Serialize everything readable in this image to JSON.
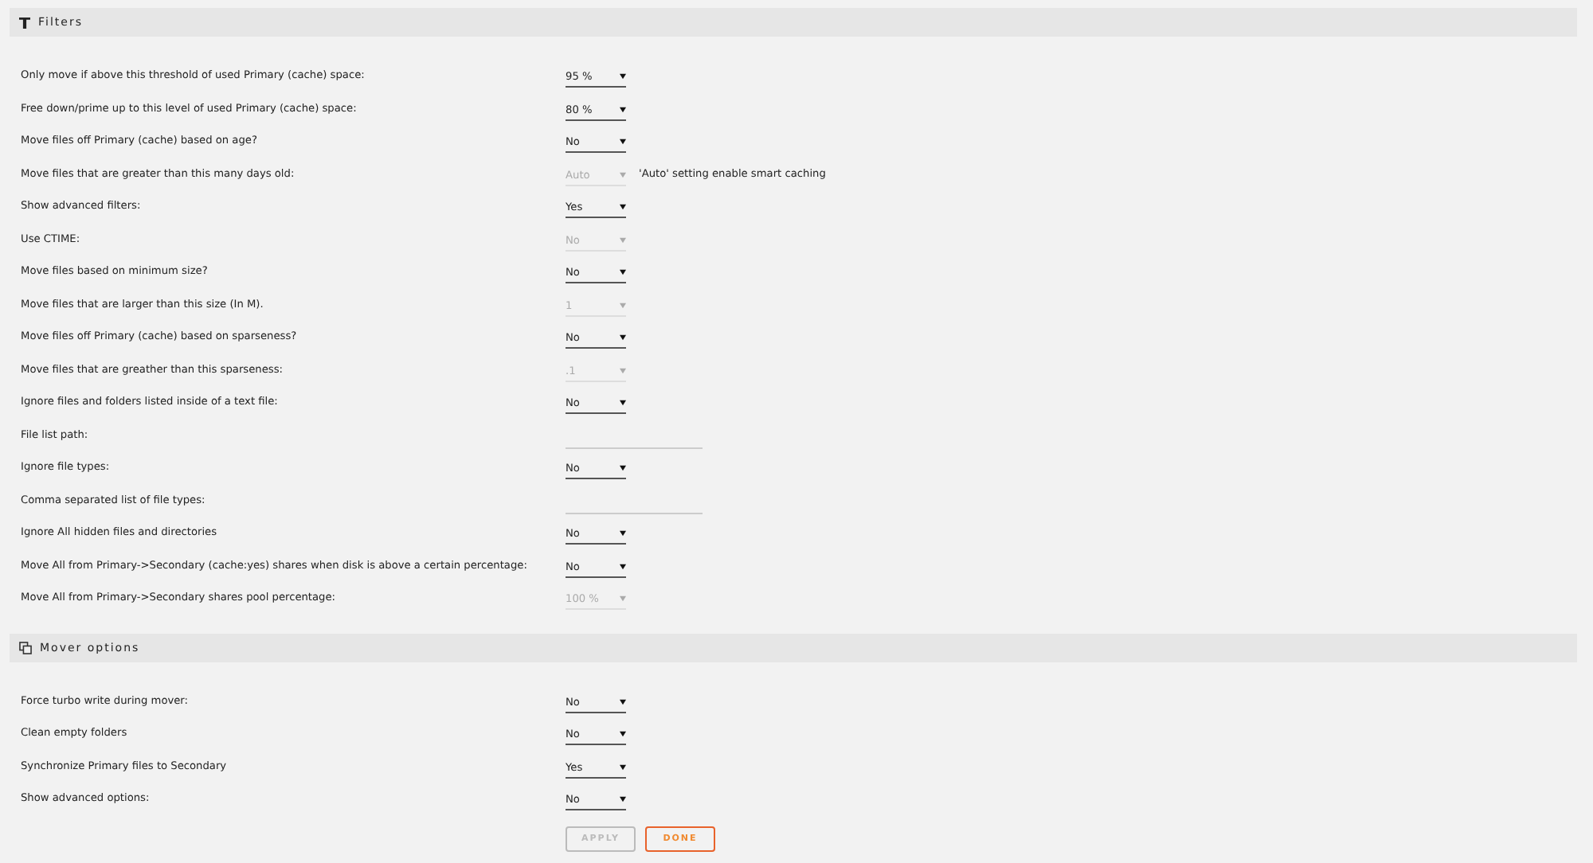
{
  "sections": [
    {
      "title": "Filters",
      "rows": [
        {
          "label": "Only move if above this threshold of used Primary (cache) space:",
          "kind": "select",
          "value": "95 %",
          "disabled": false
        },
        {
          "label": "Free down/prime up to this level of used Primary (cache) space:",
          "kind": "select",
          "value": "80 %",
          "disabled": false
        },
        {
          "label": "Move files off Primary (cache) based on age?",
          "kind": "select",
          "value": "No",
          "disabled": false
        },
        {
          "label": "Move files that are greater than this many days old:",
          "kind": "select",
          "value": "Auto",
          "disabled": true,
          "note": "'Auto' setting enable smart caching"
        },
        {
          "label": "Show advanced filters:",
          "kind": "select",
          "value": "Yes",
          "disabled": false
        },
        {
          "label": "Use CTIME:",
          "kind": "select",
          "value": "No",
          "disabled": true
        },
        {
          "label": "Move files based on minimum size?",
          "kind": "select",
          "value": "No",
          "disabled": false
        },
        {
          "label": "Move files that are larger than this size (In M).",
          "kind": "select",
          "value": "1",
          "disabled": true
        },
        {
          "label": "Move files off Primary (cache) based on sparseness?",
          "kind": "select",
          "value": "No",
          "disabled": false
        },
        {
          "label": "Move files that are greather than this sparseness:",
          "kind": "select",
          "value": ".1",
          "disabled": true
        },
        {
          "label": "Ignore files and folders listed inside of a text file:",
          "kind": "select",
          "value": "No",
          "disabled": false
        },
        {
          "label": "File list path:",
          "kind": "text"
        },
        {
          "label": "Ignore file types:",
          "kind": "select",
          "value": "No",
          "disabled": false
        },
        {
          "label": "Comma separated list of file types:",
          "kind": "text"
        },
        {
          "label": "Ignore All hidden files and directories",
          "kind": "select",
          "value": "No",
          "disabled": false
        },
        {
          "label": "Move All from Primary->Secondary (cache:yes) shares when disk is above a certain percentage:",
          "kind": "select",
          "value": "No",
          "disabled": false
        },
        {
          "label": "Move All from Primary->Secondary shares pool percentage:",
          "kind": "select",
          "value": "100 %",
          "disabled": true
        }
      ]
    },
    {
      "title": "Mover options",
      "rows": [
        {
          "label": "Force turbo write during mover:",
          "kind": "select",
          "value": "No",
          "disabled": false
        },
        {
          "label": "Clean empty folders",
          "kind": "select",
          "value": "No",
          "disabled": false
        },
        {
          "label": "Synchronize Primary files to Secondary",
          "kind": "select",
          "value": "Yes",
          "disabled": false
        },
        {
          "label": "Show advanced options:",
          "kind": "select",
          "value": "No",
          "disabled": false
        }
      ]
    }
  ],
  "buttons": [
    {
      "label": "APPLY",
      "disabled": true
    },
    {
      "label": "DONE",
      "disabled": false
    }
  ]
}
